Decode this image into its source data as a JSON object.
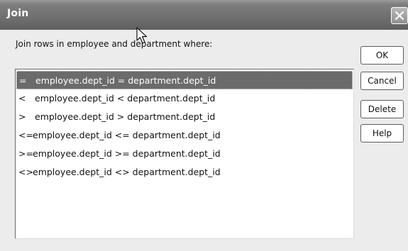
{
  "window": {
    "title": "Join"
  },
  "prompt": "Join rows in employee and department where:",
  "rows": [
    {
      "op": "=",
      "expr": "employee.dept_id = department.dept_id",
      "selected": true
    },
    {
      "op": "<",
      "expr": "employee.dept_id < department.dept_id",
      "selected": false
    },
    {
      "op": ">",
      "expr": "employee.dept_id > department.dept_id",
      "selected": false
    },
    {
      "op": "<=",
      "expr": "employee.dept_id <= department.dept_id",
      "selected": false
    },
    {
      "op": ">=",
      "expr": "employee.dept_id >= department.dept_id",
      "selected": false
    },
    {
      "op": "<>",
      "expr": "employee.dept_id <> department.dept_id",
      "selected": false
    }
  ],
  "buttons": {
    "ok": "OK",
    "cancel": "Cancel",
    "delete": "Delete",
    "help": "Help"
  },
  "icons": {
    "close": "close-icon",
    "cursor": "mouse-pointer-icon"
  },
  "colors": {
    "titlebar": "#6f6f6f",
    "selection": "#6b6b6b",
    "background": "#ececec"
  }
}
